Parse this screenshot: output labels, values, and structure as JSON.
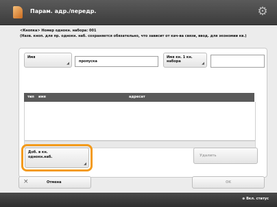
{
  "window": {
    "title": "Парам. адр./передр."
  },
  "header": {
    "line1": "<Кнопка> Номер однокн. набора: 001",
    "line2": "(Назв. кноп. для пр. однокн. наб. сохраняется обязательно, что зависит от кач-ва связи, ввод. для экономии кв.)"
  },
  "form": {
    "name_button": "Имя",
    "name_value": "пропуска",
    "name_field_button": "Имя кн. 1 кн. набора",
    "name_field_value": ""
  },
  "list": {
    "columns": [
      "тип",
      "имя",
      "адресат"
    ]
  },
  "actions": {
    "add_label": "Доб. в кн. однокн.наб.",
    "delete_label": "Удалить",
    "cancel_label": "Отмена",
    "ok_label": "OK"
  },
  "status": {
    "text": "Вкл. статус"
  }
}
